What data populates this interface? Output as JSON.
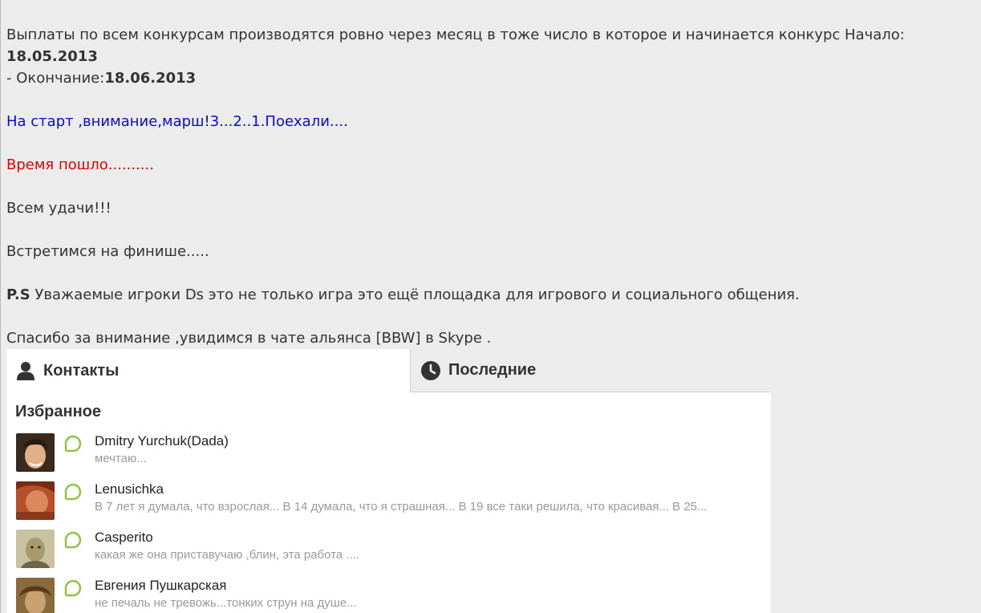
{
  "post": {
    "line1_text": "Выплаты по всем конкурсам производятся ровно через месяц в тоже число в которое и начинается конкурс Начало: ",
    "start_date": "18.05.2013",
    "line2_text": "- Окончание:",
    "end_date": "18.06.2013",
    "start_line": "На старт ,внимание,марш!3...2..1.Поехали....",
    "time_line": "Время пошло..........",
    "luck_line": "Всем удачи!!!",
    "finish_line": "Встретимся на финише.....",
    "ps_label": "P.S",
    "ps_text": " Уважаемые игроки Ds это не только игра это ещё площадка для игрового и социального общения.",
    "thanks_line": "Спасибо за внимание ,увидимся в чате альянса [BBW] в Skype ."
  },
  "skype": {
    "tabs": [
      {
        "label": "Контакты",
        "icon": "person-icon",
        "active": true
      },
      {
        "label": "Последние",
        "icon": "clock-icon",
        "active": false
      }
    ],
    "section_title": "Избранное",
    "contacts": [
      {
        "name": "Dmitry Yurchuk(Dada)",
        "mood": "мечтаю...",
        "status": "online"
      },
      {
        "name": "Lenusichka",
        "mood": "В 7 лет я думала, что взрослая... В 14 думала, что я страшная... В 19 все таки решила, что красивая... В 25...",
        "status": "online"
      },
      {
        "name": "Casperito",
        "mood": "какая же она приставучаю ,блин, эта работа ....",
        "status": "online"
      },
      {
        "name": "Евгения Пушкарская",
        "mood": "не печаль не тревожь...тонких струн на душе...",
        "status": "online"
      }
    ],
    "colors": {
      "status_online": "#8cc63f",
      "tab_inactive_bg": "#ececec",
      "panel_bg": "#ffffff"
    }
  }
}
